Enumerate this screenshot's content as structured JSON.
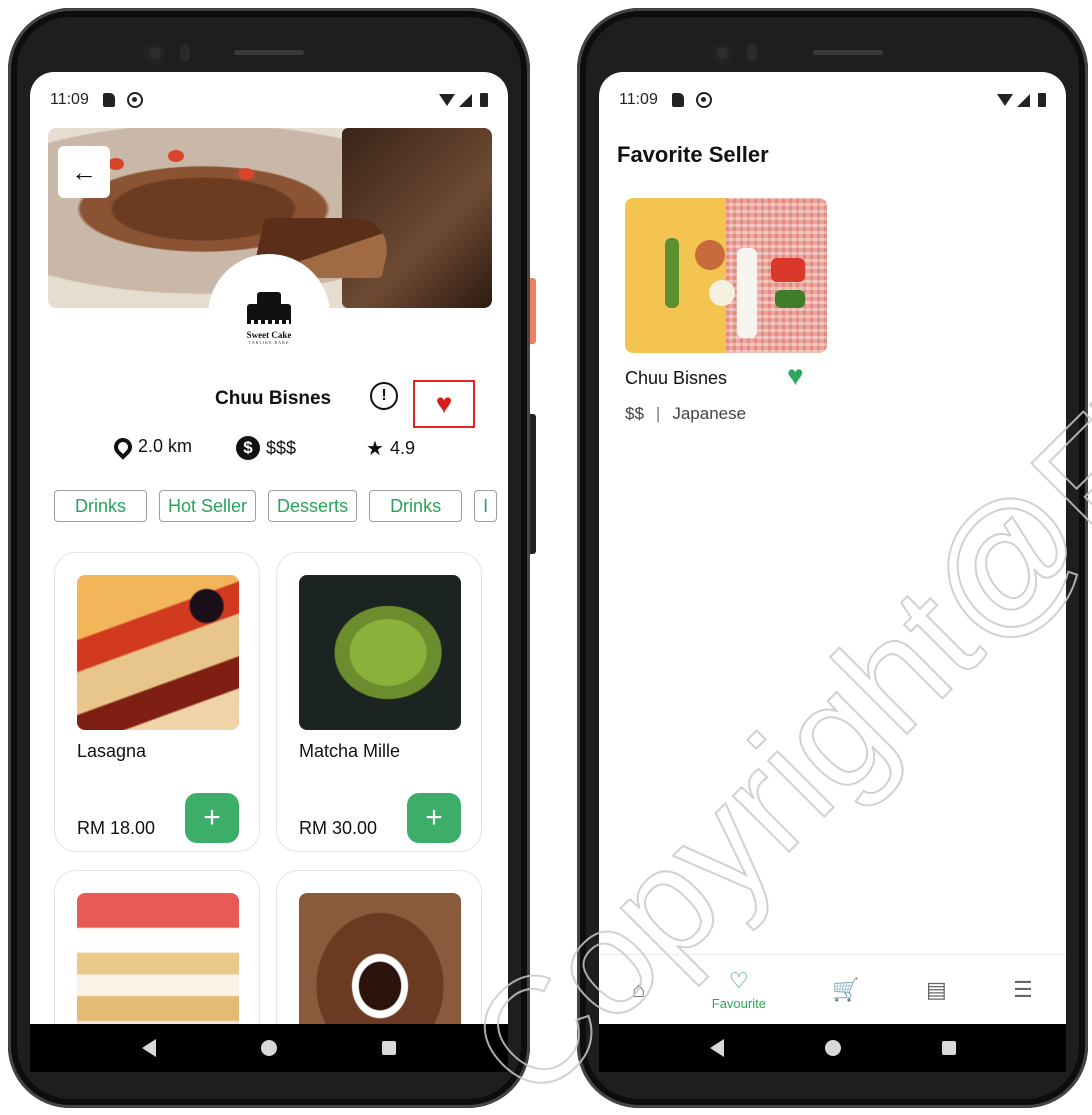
{
  "left_screen": {
    "status": {
      "time": "11:09"
    },
    "back_label": "←",
    "logo": {
      "name": "Sweet Cake",
      "tagline": "TARLIKE BAKE"
    },
    "shop_name": "Chuu Bisnes",
    "info_symbol": "!",
    "favorite_symbol": "♥",
    "stats": {
      "distance": "2.0 km",
      "price_symbol": "$",
      "price": "$$$",
      "star_symbol": "★",
      "rating": "4.9"
    },
    "categories": [
      "Drinks",
      "Hot Seller",
      "Desserts",
      "Drinks",
      "I"
    ],
    "products": [
      {
        "name": "Lasagna",
        "price": "RM 18.00"
      },
      {
        "name": "Matcha Mille",
        "price": "RM 30.00"
      },
      {
        "name": "",
        "price": ""
      },
      {
        "name": "",
        "price": ""
      }
    ],
    "add_symbol": "+"
  },
  "right_screen": {
    "status": {
      "time": "11:09"
    },
    "title": "Favorite Seller",
    "seller": {
      "name": "Chuu Bisnes",
      "price": "$$",
      "separator": "|",
      "cuisine": "Japanese",
      "heart": "♥"
    },
    "tabs": [
      {
        "icon": "home-icon",
        "glyph": "⌂",
        "label": ""
      },
      {
        "icon": "favourite-icon",
        "glyph": "♡",
        "label": "Favourite"
      },
      {
        "icon": "cart-icon",
        "glyph": "🛒",
        "label": ""
      },
      {
        "icon": "news-icon",
        "glyph": "▤",
        "label": ""
      },
      {
        "icon": "profile-icon",
        "glyph": "☰",
        "label": ""
      }
    ]
  },
  "watermark": "Copyright@FTSM UKM",
  "colors": {
    "accent_green": "#2ea65b",
    "heart_red": "#d91c1c",
    "highlight_red": "#e02626"
  }
}
